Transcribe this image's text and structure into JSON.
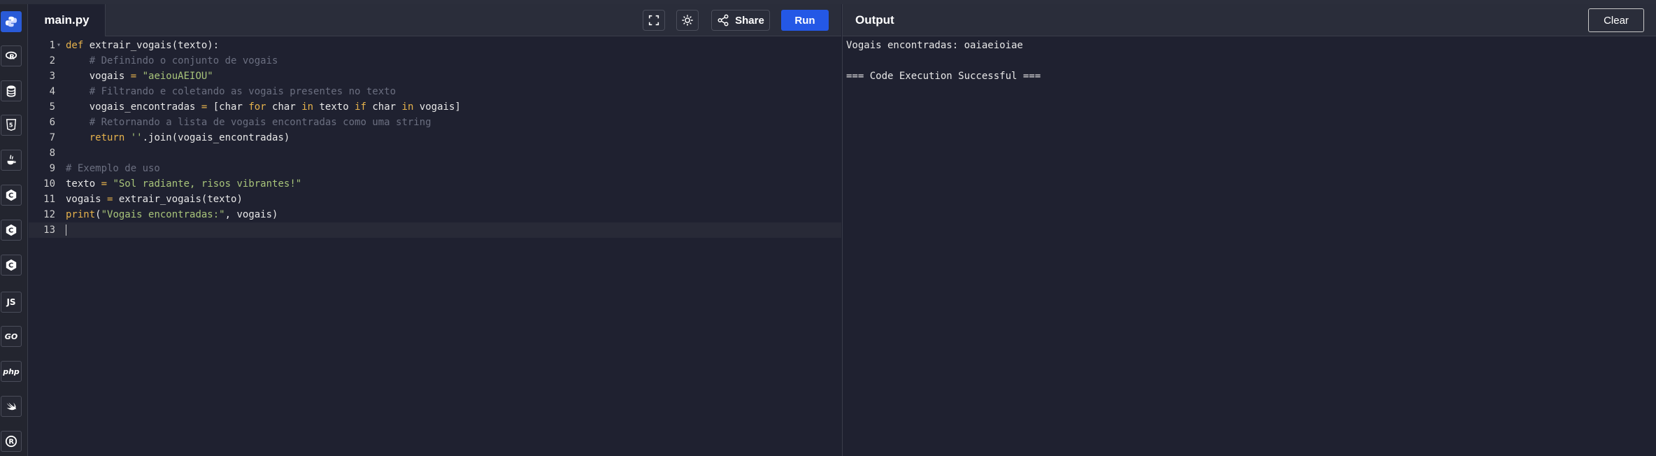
{
  "editor": {
    "file_tab": "main.py",
    "share_label": "Share",
    "run_label": "Run",
    "lines": [
      {
        "n": "1",
        "tokens": [
          {
            "t": "def ",
            "c": "kw"
          },
          {
            "t": "extrair_vogais(texto):",
            "c": ""
          }
        ]
      },
      {
        "n": "2",
        "tokens": [
          {
            "t": "    ",
            "c": ""
          },
          {
            "t": "# Definindo o conjunto de vogais",
            "c": "cm"
          }
        ]
      },
      {
        "n": "3",
        "tokens": [
          {
            "t": "    vogais ",
            "c": ""
          },
          {
            "t": "=",
            "c": "op"
          },
          {
            "t": " ",
            "c": ""
          },
          {
            "t": "\"aeiouAEIOU\"",
            "c": "st"
          }
        ]
      },
      {
        "n": "4",
        "tokens": [
          {
            "t": "    ",
            "c": ""
          },
          {
            "t": "# Filtrando e coletando as vogais presentes no texto",
            "c": "cm"
          }
        ]
      },
      {
        "n": "5",
        "tokens": [
          {
            "t": "    vogais_encontradas ",
            "c": ""
          },
          {
            "t": "=",
            "c": "op"
          },
          {
            "t": " [char ",
            "c": ""
          },
          {
            "t": "for",
            "c": "kw"
          },
          {
            "t": " char ",
            "c": ""
          },
          {
            "t": "in",
            "c": "kw"
          },
          {
            "t": " texto ",
            "c": ""
          },
          {
            "t": "if",
            "c": "kw"
          },
          {
            "t": " char ",
            "c": ""
          },
          {
            "t": "in",
            "c": "kw"
          },
          {
            "t": " vogais]",
            "c": ""
          }
        ]
      },
      {
        "n": "6",
        "tokens": [
          {
            "t": "    ",
            "c": ""
          },
          {
            "t": "# Retornando a lista de vogais encontradas como uma string",
            "c": "cm"
          }
        ]
      },
      {
        "n": "7",
        "tokens": [
          {
            "t": "    ",
            "c": ""
          },
          {
            "t": "return",
            "c": "kw"
          },
          {
            "t": " ",
            "c": ""
          },
          {
            "t": "''",
            "c": "st"
          },
          {
            "t": ".join(vogais_encontradas)",
            "c": ""
          }
        ]
      },
      {
        "n": "8",
        "tokens": []
      },
      {
        "n": "9",
        "tokens": [
          {
            "t": "# Exemplo de uso",
            "c": "cm"
          }
        ]
      },
      {
        "n": "10",
        "tokens": [
          {
            "t": "texto ",
            "c": ""
          },
          {
            "t": "=",
            "c": "op"
          },
          {
            "t": " ",
            "c": ""
          },
          {
            "t": "\"Sol radiante, risos vibrantes!\"",
            "c": "st"
          }
        ]
      },
      {
        "n": "11",
        "tokens": [
          {
            "t": "vogais ",
            "c": ""
          },
          {
            "t": "=",
            "c": "op"
          },
          {
            "t": " extrair_vogais(texto)",
            "c": ""
          }
        ]
      },
      {
        "n": "12",
        "tokens": [
          {
            "t": "print",
            "c": "kw"
          },
          {
            "t": "(",
            "c": ""
          },
          {
            "t": "\"Vogais encontradas:\"",
            "c": "st"
          },
          {
            "t": ", vogais)",
            "c": ""
          }
        ]
      },
      {
        "n": "13",
        "tokens": []
      }
    ]
  },
  "output": {
    "title": "Output",
    "clear_label": "Clear",
    "lines": [
      "Vogais encontradas: oaiaeioiae",
      "",
      "=== Code Execution Successful ==="
    ]
  },
  "sidebar": {
    "items": [
      {
        "name": "python-icon",
        "label": ""
      },
      {
        "name": "r-icon",
        "label": ""
      },
      {
        "name": "sql-icon",
        "label": ""
      },
      {
        "name": "html5-icon",
        "label": ""
      },
      {
        "name": "java-icon",
        "label": ""
      },
      {
        "name": "c-icon",
        "label": ""
      },
      {
        "name": "cpp-icon",
        "label": ""
      },
      {
        "name": "csharp-icon",
        "label": ""
      },
      {
        "name": "javascript-icon",
        "label": "JS"
      },
      {
        "name": "go-icon",
        "label": "GO"
      },
      {
        "name": "php-icon",
        "label": "php"
      },
      {
        "name": "swift-icon",
        "label": ""
      },
      {
        "name": "rust-icon",
        "label": ""
      }
    ]
  },
  "colors": {
    "accent": "#2458e6",
    "background": "#1f2130",
    "keyword": "#e6b24c",
    "string": "#a8c47a",
    "comment": "#6b6f80"
  }
}
